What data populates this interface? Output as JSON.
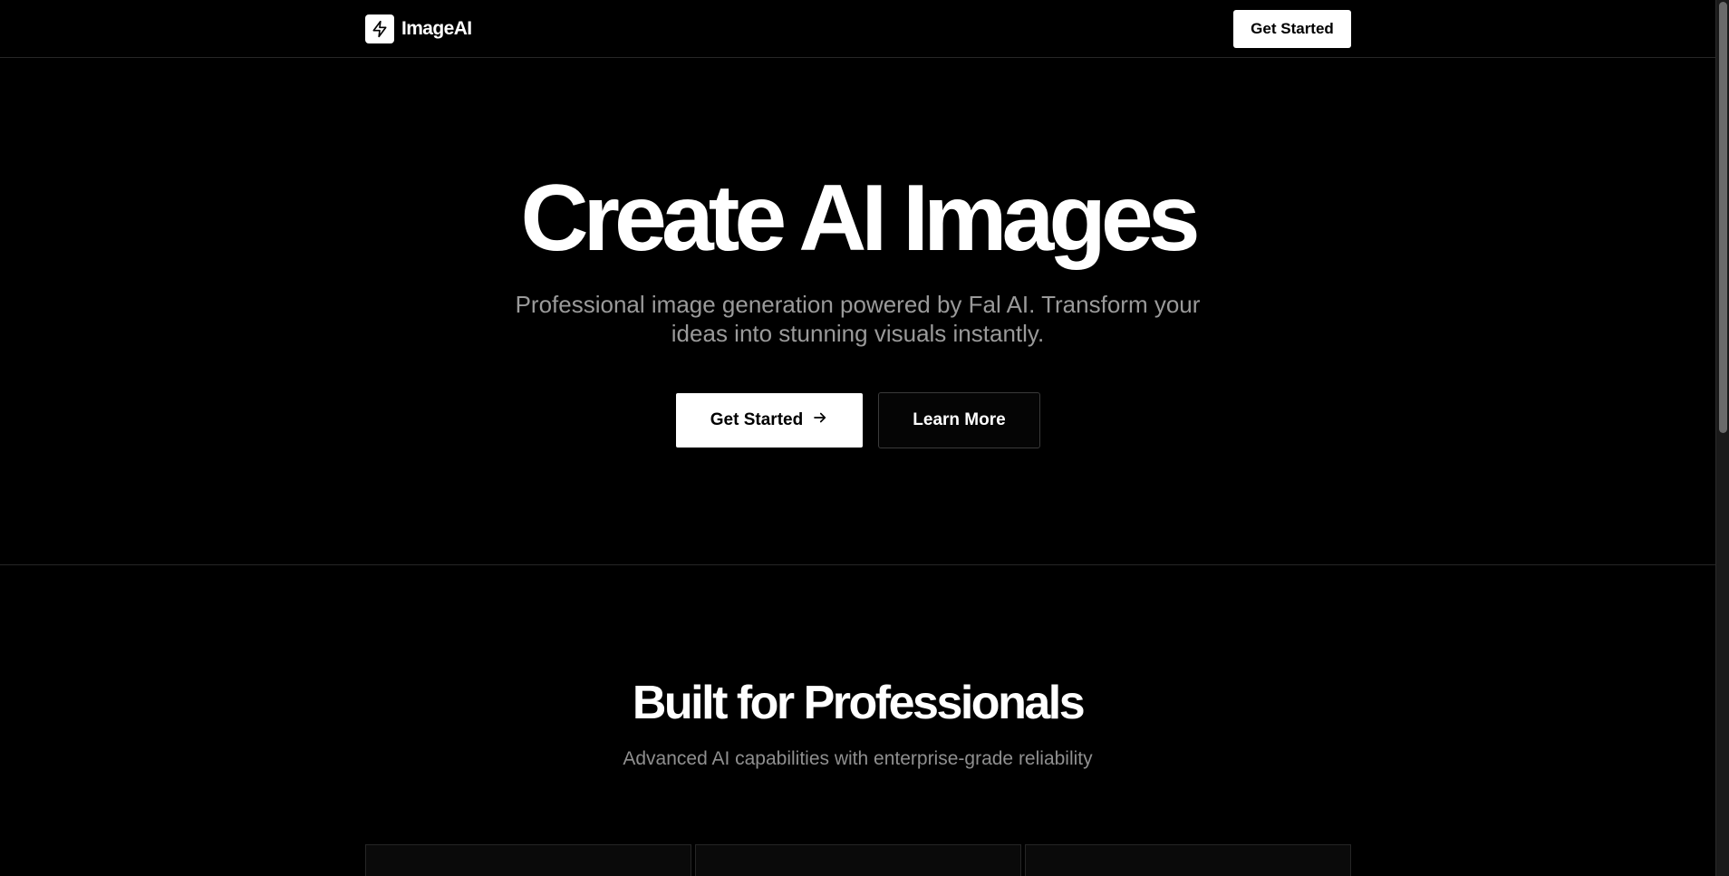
{
  "header": {
    "brand": "ImageAI",
    "logo_icon": "lightning-bolt-icon",
    "cta_label": "Get Started"
  },
  "hero": {
    "title": "Create AI Images",
    "subtitle": "Professional image generation powered by Fal AI. Transform your ideas into stunning visuals instantly.",
    "primary_label": "Get Started",
    "primary_icon": "arrow-right-icon",
    "secondary_label": "Learn More"
  },
  "features": {
    "title": "Built for Professionals",
    "subtitle": "Advanced AI capabilities with enterprise-grade reliability"
  },
  "colors": {
    "background": "#000000",
    "text": "#ffffff",
    "muted_text": "#9a9a9a",
    "border": "#262626"
  }
}
